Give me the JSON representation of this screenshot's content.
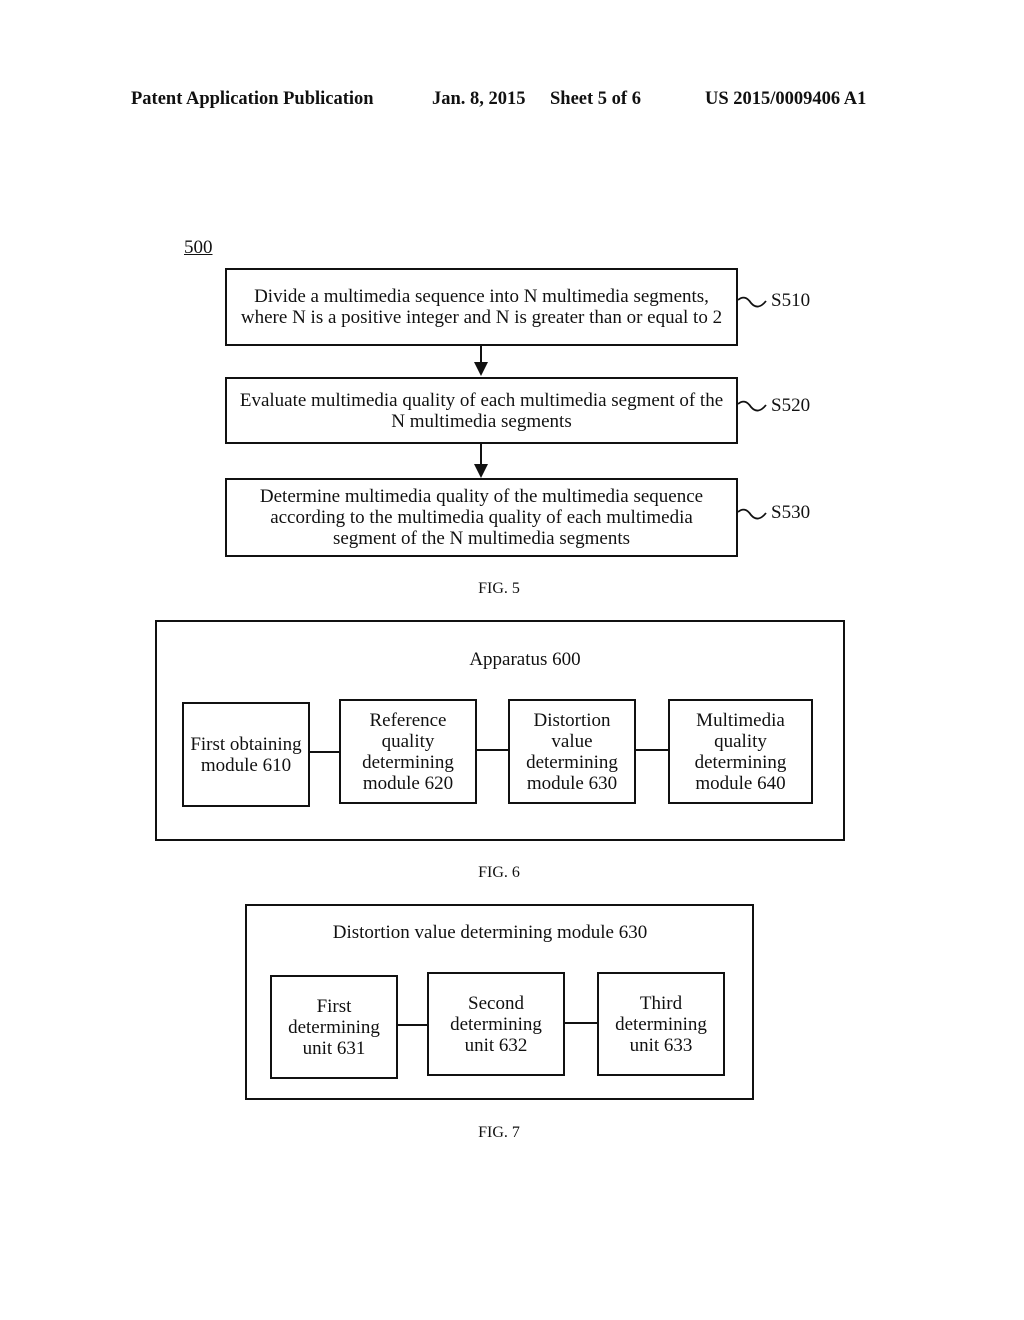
{
  "header": {
    "publication": "Patent Application Publication",
    "date": "Jan. 8, 2015",
    "sheet": "Sheet 5 of 6",
    "number": "US 2015/0009406 A1"
  },
  "fig5": {
    "ref": "500",
    "steps": [
      {
        "id": "S510",
        "text": "Divide a multimedia sequence into N multimedia segments, where N is a positive integer and N is greater than or equal to 2"
      },
      {
        "id": "S520",
        "text": "Evaluate multimedia quality of each multimedia segment of the N multimedia segments"
      },
      {
        "id": "S530",
        "text": "Determine multimedia quality of the multimedia sequence according to the multimedia quality of each multimedia segment of the N multimedia segments"
      }
    ],
    "caption": "FIG. 5"
  },
  "fig6": {
    "title": "Apparatus 600",
    "modules": [
      {
        "text": "First obtaining module 610"
      },
      {
        "text": "Reference quality determining module 620"
      },
      {
        "text": "Distortion value determining module 630"
      },
      {
        "text": "Multimedia quality determining module 640"
      }
    ],
    "caption": "FIG. 6"
  },
  "fig7": {
    "title": "Distortion value determining module 630",
    "units": [
      {
        "text": "First determining unit 631"
      },
      {
        "text": "Second determining unit 632"
      },
      {
        "text": "Third determining unit 633"
      }
    ],
    "caption": "FIG. 7"
  }
}
